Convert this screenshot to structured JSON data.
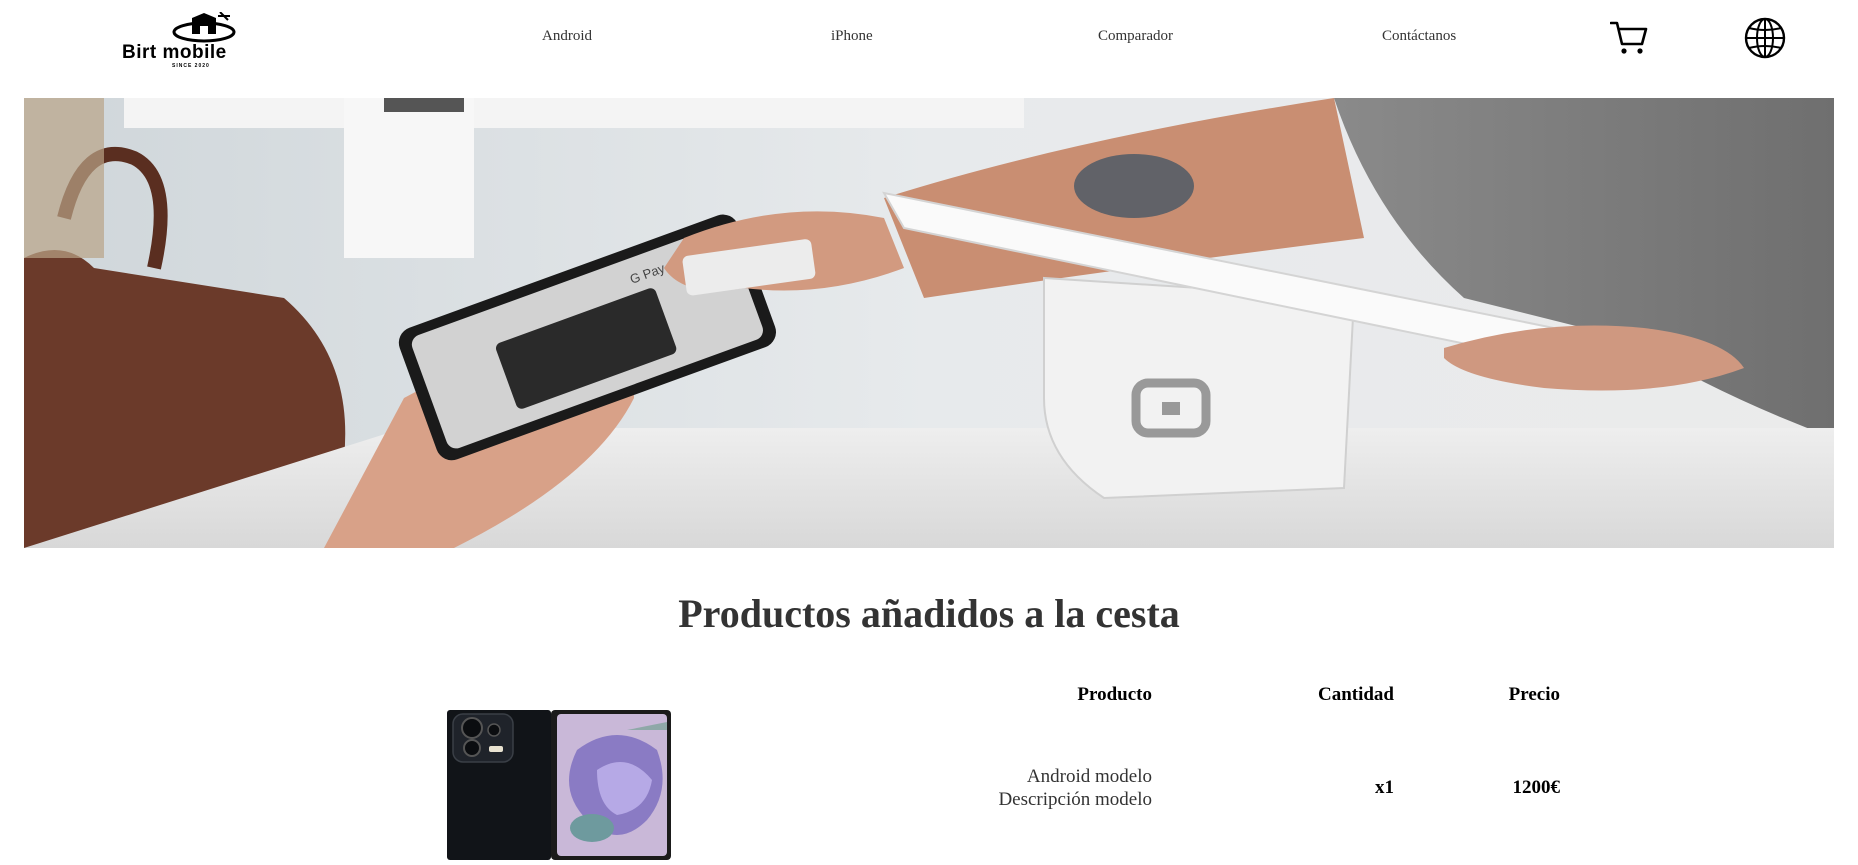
{
  "brand": {
    "name": "Birt mobile",
    "tagline": "SINCE 2020"
  },
  "nav": [
    {
      "label": "Android"
    },
    {
      "label": "iPhone"
    },
    {
      "label": "Comparador"
    },
    {
      "label": "Contáctanos"
    }
  ],
  "header_icons": [
    "cart-icon",
    "globe-icon"
  ],
  "hero": {
    "screen_brand": "G Pay"
  },
  "cart": {
    "title": "Productos añadidos a la cesta",
    "columns": {
      "product": "Producto",
      "quantity": "Cantidad",
      "price": "Precio"
    },
    "items": [
      {
        "name": "Android modelo",
        "description": "Descripción modelo",
        "quantity": "x1",
        "price": "1200€"
      }
    ]
  },
  "colors": {
    "title": "#333333",
    "accent": "#000000",
    "background": "#ffffff"
  }
}
